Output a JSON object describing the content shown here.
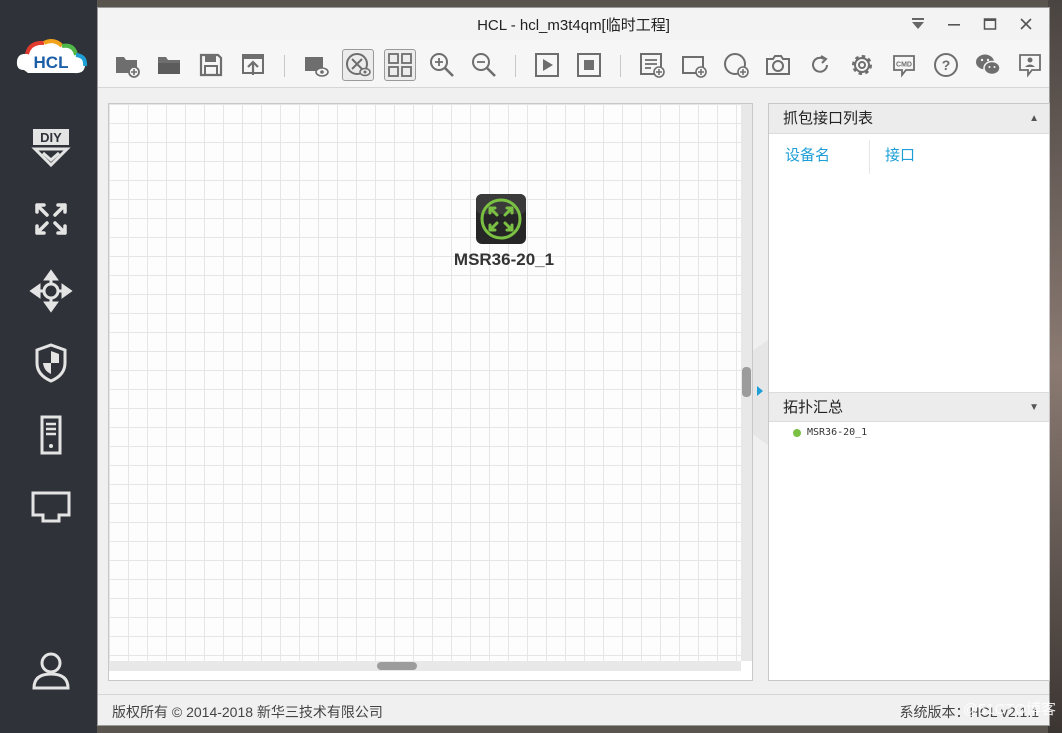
{
  "window": {
    "title": "HCL - hcl_m3t4qm[临时工程]"
  },
  "logo": {
    "text": "HCL"
  },
  "sidebar": {
    "items": [
      {
        "icon": "diy-icon"
      },
      {
        "icon": "router-icon"
      },
      {
        "icon": "switch-icon"
      },
      {
        "icon": "firewall-icon"
      },
      {
        "icon": "server-icon"
      },
      {
        "icon": "network-port-icon"
      },
      {
        "icon": "user-icon"
      }
    ]
  },
  "toolbar": {
    "buttons": [
      "new-project",
      "open-project",
      "save",
      "export",
      "show-labels",
      "show-ports",
      "grid",
      "zoom-in",
      "zoom-out",
      "start-all",
      "stop-all",
      "capture-list",
      "add-rect",
      "add-ellipse",
      "screenshot",
      "refresh",
      "settings",
      "cmd",
      "help",
      "wechat",
      "feedback"
    ]
  },
  "canvas": {
    "device": {
      "name": "MSR36-20_1",
      "color": "#7ac143"
    }
  },
  "capture_panel": {
    "title": "抓包接口列表",
    "columns": [
      "设备名",
      "接口"
    ]
  },
  "topology_panel": {
    "title": "拓扑汇总",
    "items": [
      "MSR36-20_1"
    ]
  },
  "statusbar": {
    "copyright": "版权所有 © 2014-2018 新华三技术有限公司",
    "version": "系统版本：HCL v2.1.1"
  },
  "watermark": "@51CTO博客",
  "colors": {
    "accent": "#1e9fd6",
    "device_green": "#7ac143",
    "sidebar": "#2f3238"
  }
}
